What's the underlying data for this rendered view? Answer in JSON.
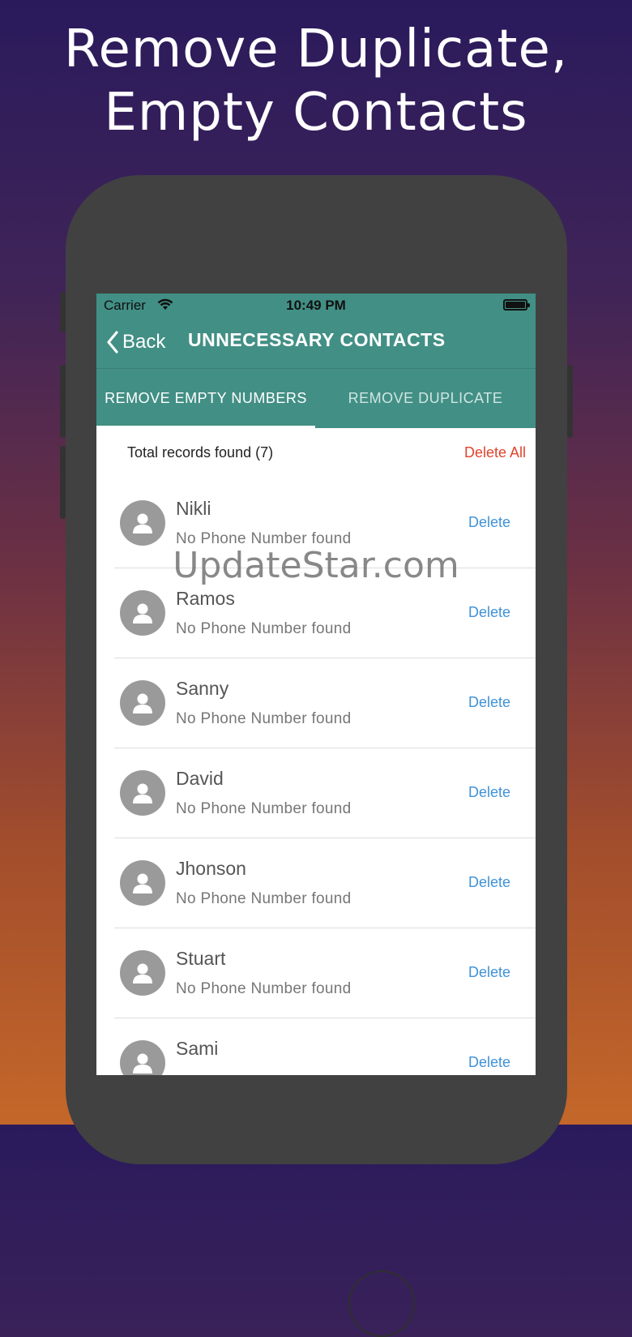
{
  "promo": {
    "title_line1": "Remove Duplicate,",
    "title_line2": "Empty Contacts"
  },
  "status_bar": {
    "carrier": "Carrier",
    "time": "10:49 PM"
  },
  "nav": {
    "back_label": "Back",
    "title": "UNNECESSARY CONTACTS"
  },
  "tabs": [
    {
      "label": "REMOVE EMPTY NUMBERS",
      "active": true
    },
    {
      "label": "REMOVE DUPLICATE",
      "active": false
    }
  ],
  "summary": {
    "total_label": "Total records found (7)",
    "delete_all_label": "Delete All"
  },
  "contacts": [
    {
      "name": "Nikli",
      "subtitle": "No Phone Number found",
      "action": "Delete"
    },
    {
      "name": "Ramos",
      "subtitle": "No Phone Number found",
      "action": "Delete"
    },
    {
      "name": "Sanny",
      "subtitle": "No Phone Number found",
      "action": "Delete"
    },
    {
      "name": "David",
      "subtitle": "No Phone Number found",
      "action": "Delete"
    },
    {
      "name": "Jhonson",
      "subtitle": "No Phone Number found",
      "action": "Delete"
    },
    {
      "name": "Stuart",
      "subtitle": "No Phone Number found",
      "action": "Delete"
    },
    {
      "name": "Sami",
      "subtitle": "",
      "action": "Delete"
    }
  ],
  "watermark": "UpdateStar.com",
  "colors": {
    "appbar": "#428f85",
    "delete_all": "#e0442e",
    "row_delete": "#3f92d8",
    "avatar": "#9a9a9a"
  },
  "icons": {
    "wifi": "wifi-icon",
    "battery": "battery-icon",
    "back": "chevron-left-icon",
    "avatar": "person-icon"
  }
}
